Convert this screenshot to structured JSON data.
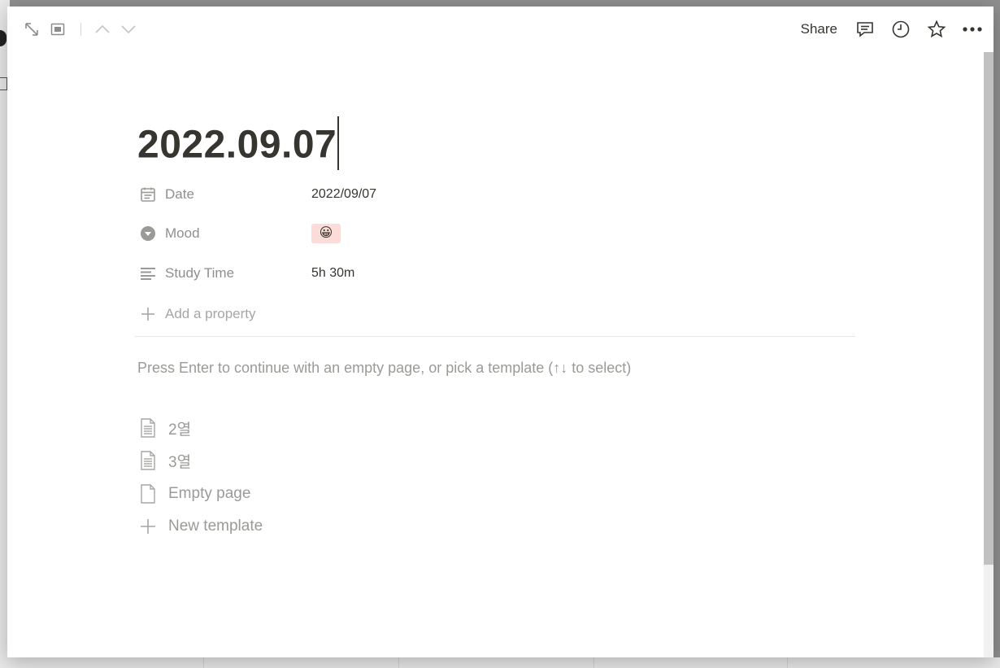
{
  "topbar": {
    "share_label": "Share",
    "left_icons": [
      "expand-icon",
      "peek-mode-icon",
      "chevron-up-icon",
      "chevron-down-icon"
    ],
    "right_icons": [
      "comment-icon",
      "clock-icon",
      "star-icon",
      "more-icon"
    ]
  },
  "page": {
    "title": "2022.09.07"
  },
  "properties": [
    {
      "name": "Date",
      "icon": "calendar-icon",
      "value": "2022/09/07"
    },
    {
      "name": "Mood",
      "icon": "select-icon",
      "value": "😀"
    },
    {
      "name": "Study Time",
      "icon": "text-lines-icon",
      "value": "5h 30m"
    }
  ],
  "add_property_label": "Add a property",
  "hint_text": "Press Enter to continue with an empty page, or pick a template (↑↓ to select)",
  "templates": [
    {
      "label": "2열",
      "icon": "document-icon"
    },
    {
      "label": "3열",
      "icon": "document-icon"
    },
    {
      "label": "Empty page",
      "icon": "empty-page-icon"
    },
    {
      "label": "New template",
      "icon": "plus-icon"
    }
  ],
  "colors": {
    "text": "#37352f",
    "muted": "#9b9a97",
    "mood_tag_bg": "#fbdcd8"
  }
}
